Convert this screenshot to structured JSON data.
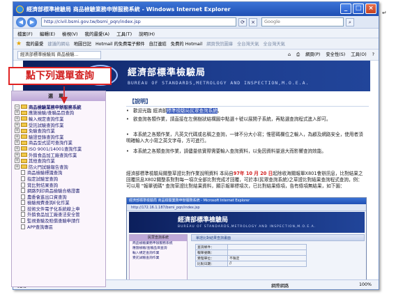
{
  "window": {
    "title": "經濟部標準檢驗局 商品檢驗業務申辦服務系統 - Windows Internet Explorer",
    "buttons": {
      "minimize": "_",
      "maximize": "□",
      "close": "×"
    }
  },
  "address_bar": {
    "back": "◀",
    "forward": "▶",
    "url": "http://civil.bsmi.gov.tw/bsmi_pqn/index.jsp",
    "search_placeholder": "Google"
  },
  "menu": [
    "檔案(F)",
    "編輯(E)",
    "檢視(V)",
    "我的最愛(A)",
    "工具(T)",
    "說明(H)"
  ],
  "favorites": {
    "label": "我的最愛",
    "items": [
      {
        "label": "建議的網站",
        "dim": true
      },
      {
        "label": "地圖日記",
        "dim": false
      },
      {
        "label": "Hotmail 的免費電子郵件",
        "dim": false
      },
      {
        "label": "自訂連結",
        "dim": false
      },
      {
        "label": "免費的 Hotmail",
        "dim": false
      },
      {
        "label": "網頁快訊圖庫",
        "dim": true
      },
      {
        "label": "全台灣天氣",
        "dim": true
      },
      {
        "label": "全台灣天氣",
        "dim": true
      }
    ]
  },
  "command_bar": {
    "tab_label": "經濟部標準檢驗局 商品檢驗...",
    "page_label": "網頁(P)",
    "safety_label": "安全性(S)",
    "tools_label": "工具(O)"
  },
  "banner": {
    "title": "經濟部標準檢驗局",
    "subtitle": "BUREAU OF STANDARDS,METROLOGY AND INSPECTION,M.O.E.A."
  },
  "callout": {
    "text": "點下列選單查詢"
  },
  "left_menu": {
    "header": "選單",
    "root": "商品檢驗業務申辦服務系統",
    "items": [
      {
        "label": "應施檢驗/查驗品目查詢",
        "type": "folder"
      },
      {
        "label": "輸入規定查詢作業",
        "type": "folder"
      },
      {
        "label": "受託試驗查詢作業",
        "type": "folder"
      },
      {
        "label": "免驗查詢作業",
        "type": "folder"
      },
      {
        "label": "驗證登錄查詢作業",
        "type": "folder"
      },
      {
        "label": "商品型式認可查詢作業",
        "type": "folder"
      },
      {
        "label": "ISO 9001/14001查詢作業",
        "type": "folder"
      },
      {
        "label": "外銷食品加工廠查詢作業",
        "type": "folder"
      },
      {
        "label": "其他查詢作業",
        "type": "folder"
      },
      {
        "label": "防火門試驗報告查詢",
        "type": "folder"
      },
      {
        "label": "商品檢驗標識查詢",
        "type": "page"
      },
      {
        "label": "指定試驗室查詢",
        "type": "page"
      },
      {
        "label": "賞比對結果查詢",
        "type": "page"
      },
      {
        "label": "網路列印商品檢驗合格證書",
        "type": "page"
      },
      {
        "label": "農委會進出口資查詢",
        "type": "page"
      },
      {
        "label": "檢驗規費查詢E化作業",
        "type": "page"
      },
      {
        "label": "技術文件電子化系統線上申",
        "type": "page"
      },
      {
        "label": "外銷食品加工廠查法安全管",
        "type": "page"
      },
      {
        "label": "監視查驗及賠償查驗申請作",
        "type": "page"
      },
      {
        "label": "APP查詢專區",
        "type": "page"
      }
    ]
  },
  "notice": {
    "heading": "【說明】",
    "bullets": [
      {
        "before": "歡迎光臨 經濟部",
        "highlight": "標準檢驗局民眾查詢系統",
        "after": "。"
      },
      {
        "before": "欲查詢各類作業，請直接在左側樹狀結構圖中點選＋號以展開子系統，再點選查詢程式進入即可。",
        "highlight": "",
        "after": ""
      },
      {
        "before": "本系統之各類作業，凡英文代碼或名稱之查詢，一律不分大小寫；惟密碼欄位之輸入，為顧及網路安全，使用者須明確輸入大小寫之英文字母，方可進行。",
        "highlight": "",
        "after": ""
      },
      {
        "before": "本系統之各類查詢作業，請儘量依實際需要輸入查詢資料，以免因資料量過大而影響查詢效能。",
        "highlight": "",
        "after": ""
      }
    ],
    "paragraph": {
      "before": "經濟部標準檢驗局關整草證比對作業說明資料 本局自",
      "date": "97年 10 月 20 日",
      "after": "起除收海關報單X801會辦訊息，比對結果之 回覆訊息X802關整系對對每一項次全部比對完成才回覆，可於本(民眾查詢系統)之草證比對結果查詢程式查詢，例：可以用 \"報單號碼\" 查詢草證比對結果資料，顯示報單標項次，已比對結果條項，告有條項無結果，如下圖："
    }
  },
  "inner_screenshot": {
    "title": "經濟部標準檢驗局 商品檢驗業務申辦服務系統 - Microsoft Internet Explorer",
    "url": "http://172.16.1.187/bsmi_pqn/index.jsp",
    "banner_title": "經濟部標準檢驗局",
    "banner_subtitle": "BUREAU OF STANDARDS,METROLOGY AND INSPECTION,M.O.E.A.",
    "left_header": "民眾查詢系統",
    "left_items": [
      "商品檢驗業務申辦服務系統",
      "應施檢驗/查驗品目查詢",
      "輸入規定查詢作業",
      "受託試驗查詢作業"
    ],
    "right_header": "單證比對結果查詢畫面",
    "table": [
      {
        "k": "查詢條件：",
        "v": ""
      },
      {
        "k": "報單號碼：",
        "v": ""
      },
      {
        "k": "受理單位：",
        "v": "不限定"
      },
      {
        "k": "比對日期：",
        "v": "//"
      }
    ]
  },
  "status": {
    "text": "完成",
    "zone": "網際網路",
    "zoom": "100%"
  },
  "doc_marker": "↵"
}
